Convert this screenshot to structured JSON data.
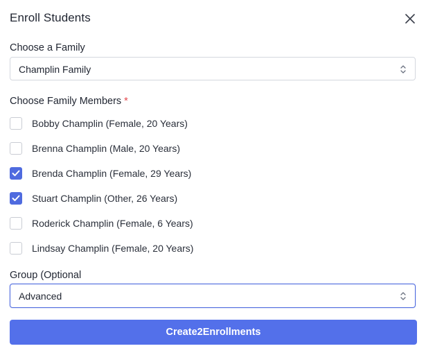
{
  "modal": {
    "title": "Enroll Students"
  },
  "family": {
    "label": "Choose a Family",
    "selected": "Champlin Family"
  },
  "members": {
    "label": "Choose Family Members",
    "required_mark": "*",
    "items": [
      {
        "label": "Bobby Champlin (Female, 20 Years)",
        "checked": false
      },
      {
        "label": "Brenna Champlin (Male, 20 Years)",
        "checked": false
      },
      {
        "label": "Brenda Champlin (Female, 29 Years)",
        "checked": true
      },
      {
        "label": "Stuart Champlin (Other, 26 Years)",
        "checked": true
      },
      {
        "label": "Roderick Champlin (Female, 6 Years)",
        "checked": false
      },
      {
        "label": "Lindsay Champlin (Female, 20 Years)",
        "checked": false
      }
    ]
  },
  "group": {
    "label": "Group (Optional",
    "selected": "Advanced"
  },
  "actions": {
    "submit_label": "Create2Enrollments"
  },
  "colors": {
    "accent": "#4f6bdf",
    "button": "#5370ea",
    "required": "#e5484d"
  },
  "icons": {
    "close": "close-icon",
    "select": "chevron-up-down-icon",
    "check": "check-icon"
  }
}
